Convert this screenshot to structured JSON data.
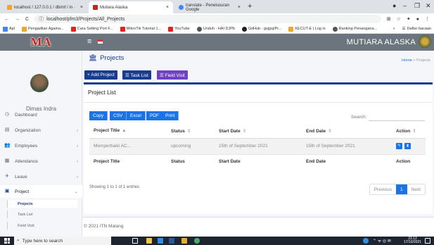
{
  "browser": {
    "tabs": [
      {
        "title": "localhost / 127.0.0.1 / dbimf / in ·",
        "color": "#f3a430"
      },
      {
        "title": "Mutiara Alaska",
        "color": "#c0261f",
        "active": true
      },
      {
        "title": "translate - Penelusuran Google",
        "color": "#4285f4"
      }
    ],
    "url": "localhost/pfm3/Projects/All_Projects",
    "bookmarks": [
      "Apl",
      "Pengadilan Agama...",
      "Cara Setting Port F...",
      "MikroTik Tutorial 1...",
      "YouTube",
      "Unduh - HAI DJPb",
      "GitHub - gsjgsj/Pr...",
      "KECUT-E | Log in",
      "Ranking Penangana..."
    ],
    "bookmark_more": "»",
    "reading_list": "Daftar bacaan"
  },
  "app": {
    "logo": "MA",
    "brand": "MUTIARA ALASKA",
    "user": "Dimas Indra",
    "nav": [
      {
        "label": "Dashboard",
        "icon": "dashboard-icon",
        "glyph": "◷",
        "chev": ""
      },
      {
        "label": "Organization",
        "icon": "organization-icon",
        "glyph": "▤",
        "chev": "›"
      },
      {
        "label": "Employees",
        "icon": "employees-icon",
        "glyph": "👥",
        "chev": "›"
      },
      {
        "label": "Attendance",
        "icon": "attendance-icon",
        "glyph": "▦",
        "chev": "›"
      },
      {
        "label": "Leave",
        "icon": "leave-icon",
        "glyph": "✈",
        "chev": "›"
      },
      {
        "label": "Project",
        "icon": "project-icon",
        "glyph": "▣",
        "chev": "⌄"
      }
    ],
    "subnav": [
      "Projects",
      "Task List",
      "Field Visit"
    ]
  },
  "page": {
    "title": "Projects",
    "breadcrumb_home": "Home",
    "breadcrumb_sep": ">",
    "breadcrumb_current": "Projects",
    "buttons": [
      {
        "label": "+ Add Project",
        "color": "#1a3c8e"
      },
      {
        "label": "☰ Task List",
        "color": "#1a3c8e"
      },
      {
        "label": "☰ Field Visit",
        "color": "#6f42c1"
      }
    ],
    "card_title": "Project List",
    "export": [
      "Copy",
      "CSV",
      "Excel",
      "PDF",
      "Print"
    ],
    "search_label": "Search:",
    "columns": [
      "Project Title",
      "Status",
      "Start Date",
      "End Date",
      "Action"
    ],
    "sort_icons": [
      "▲",
      "⇕",
      "⇕",
      "⇕",
      "⇕"
    ],
    "rows": [
      {
        "title": "Memperbaiki AC...",
        "status": "upcoming",
        "start": "15th of September 2021",
        "end": "15th of September 2021"
      }
    ],
    "info": "Showing 1 to 1 of 1 entries",
    "pager": {
      "prev": "Previous",
      "current": "1",
      "next": "Next"
    },
    "footer": "© 2021 ITN Malang"
  },
  "taskbar": {
    "search_placeholder": "Type here to search",
    "time": "23.12",
    "date": "17/10/2021"
  }
}
